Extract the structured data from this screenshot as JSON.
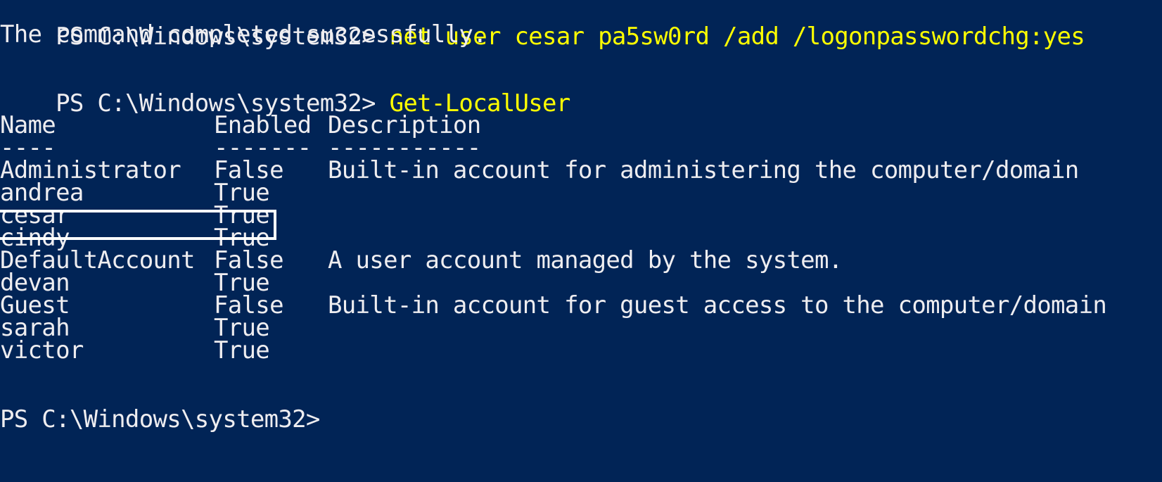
{
  "terminal": {
    "prompt": "PS C:\\Windows\\system32> ",
    "history": [
      {
        "command": "net user cesar pa5sw0rd /add /logonpasswordchg:yes"
      },
      {
        "command": "Get-LocalUser"
      }
    ],
    "output_success": "The command completed successfully.",
    "table": {
      "headers": {
        "name": "Name",
        "enabled": "Enabled",
        "description": "Description"
      },
      "separators": {
        "name": "----",
        "enabled": "-------",
        "description": "-----------"
      },
      "rows": [
        {
          "name": "Administrator",
          "enabled": "False",
          "description": "Built-in account for administering the computer/domain"
        },
        {
          "name": "andrea",
          "enabled": "True",
          "description": ""
        },
        {
          "name": "cesar",
          "enabled": "True",
          "description": ""
        },
        {
          "name": "cindy",
          "enabled": "True",
          "description": ""
        },
        {
          "name": "DefaultAccount",
          "enabled": "False",
          "description": "A user account managed by the system."
        },
        {
          "name": "devan",
          "enabled": "True",
          "description": ""
        },
        {
          "name": "Guest",
          "enabled": "False",
          "description": "Built-in account for guest access to the computer/domain"
        },
        {
          "name": "sarah",
          "enabled": "True",
          "description": ""
        },
        {
          "name": "victor",
          "enabled": "True",
          "description": ""
        }
      ],
      "highlighted_row": "cesar"
    },
    "final_prompt": "PS C:\\Windows\\system32>"
  },
  "colors": {
    "background": "#012456",
    "text": "#eeedf0",
    "command": "#ffff00",
    "highlight_border": "#ffffff"
  }
}
